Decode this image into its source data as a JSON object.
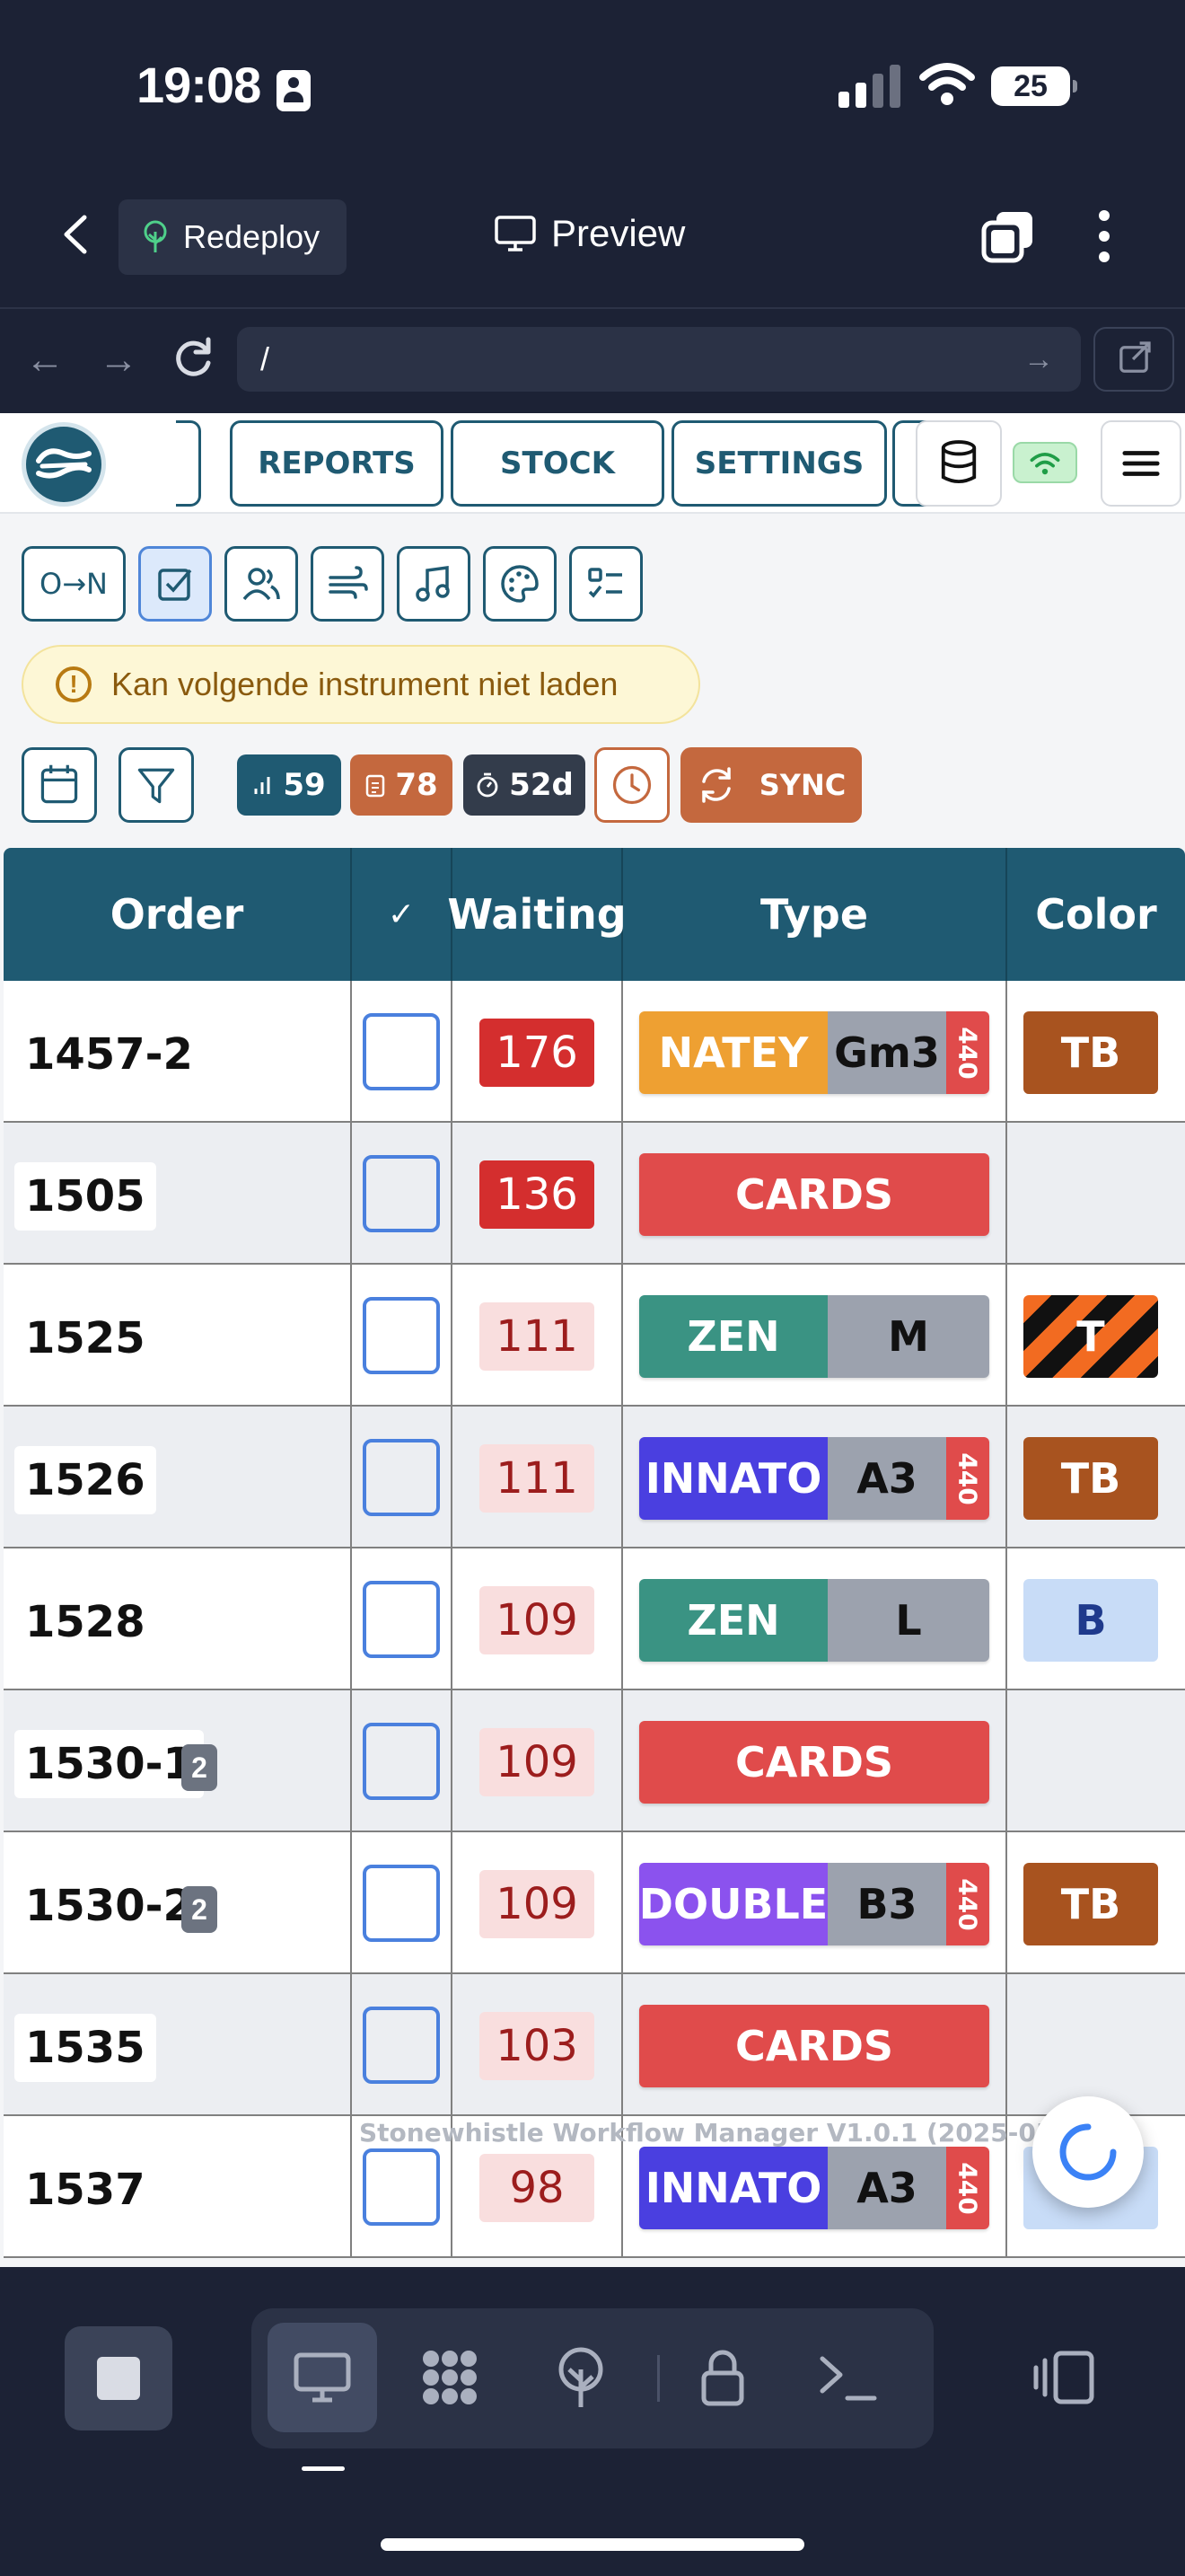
{
  "status_bar": {
    "time": "19:08",
    "battery": "25"
  },
  "browser_chrome": {
    "redeploy_label": "Redeploy",
    "preview_label": "Preview",
    "url": "/"
  },
  "app": {
    "nav_tabs": [
      "REPORTS",
      "STOCK",
      "SETTINGS"
    ],
    "toolbar_first_label": "O→N",
    "alert_text": "Kan volgende instrument niet laden",
    "stats": {
      "count": "59",
      "queue": "78",
      "age": "52d"
    },
    "sync_label": "SYNC",
    "table": {
      "headers": {
        "order": "Order",
        "check": "✓",
        "waiting": "Waiting",
        "type": "Type",
        "color": "Color"
      },
      "rows": [
        {
          "order": "1457-2",
          "badge": "",
          "waiting": "176",
          "level": "hot",
          "type": "NATEY",
          "type_color": "#eea032",
          "key": "Gm3",
          "tuning": "440",
          "color": "TB",
          "color_style": "tb"
        },
        {
          "order": "1505",
          "badge": "",
          "waiting": "136",
          "level": "hot",
          "type": "CARDS",
          "type_color": "#e04b4b",
          "key": "",
          "tuning": "",
          "color": "",
          "color_style": "none"
        },
        {
          "order": "1525",
          "badge": "",
          "waiting": "111",
          "level": "warm",
          "type": "ZEN",
          "type_color": "#3a9383",
          "key": "M",
          "tuning": "",
          "color": "T",
          "color_style": "stripe"
        },
        {
          "order": "1526",
          "badge": "",
          "waiting": "111",
          "level": "warm",
          "type": "INNATO",
          "type_color": "#4a3fe0",
          "key": "A3",
          "tuning": "440",
          "color": "TB",
          "color_style": "tb"
        },
        {
          "order": "1528",
          "badge": "",
          "waiting": "109",
          "level": "warm",
          "type": "ZEN",
          "type_color": "#3a9383",
          "key": "L",
          "tuning": "",
          "color": "B",
          "color_style": "blue"
        },
        {
          "order": "1530-1",
          "badge": "2",
          "waiting": "109",
          "level": "warm",
          "type": "CARDS",
          "type_color": "#e04b4b",
          "key": "",
          "tuning": "",
          "color": "",
          "color_style": "none"
        },
        {
          "order": "1530-2",
          "badge": "2",
          "waiting": "109",
          "level": "warm",
          "type": "DOUBLE",
          "type_color": "#8b52ee",
          "key": "B3",
          "tuning": "440",
          "color": "TB",
          "color_style": "tb"
        },
        {
          "order": "1535",
          "badge": "",
          "waiting": "103",
          "level": "warm",
          "type": "CARDS",
          "type_color": "#e04b4b",
          "key": "",
          "tuning": "",
          "color": "",
          "color_style": "none"
        },
        {
          "order": "1537",
          "badge": "",
          "waiting": "98",
          "level": "warm",
          "type": "INNATO",
          "type_color": "#4a3fe0",
          "key": "A3",
          "tuning": "440",
          "color": "",
          "color_style": "blue"
        }
      ]
    },
    "version_text": "Stonewhistle Workflow Manager V1.0.1 (2025-05-     08)"
  }
}
